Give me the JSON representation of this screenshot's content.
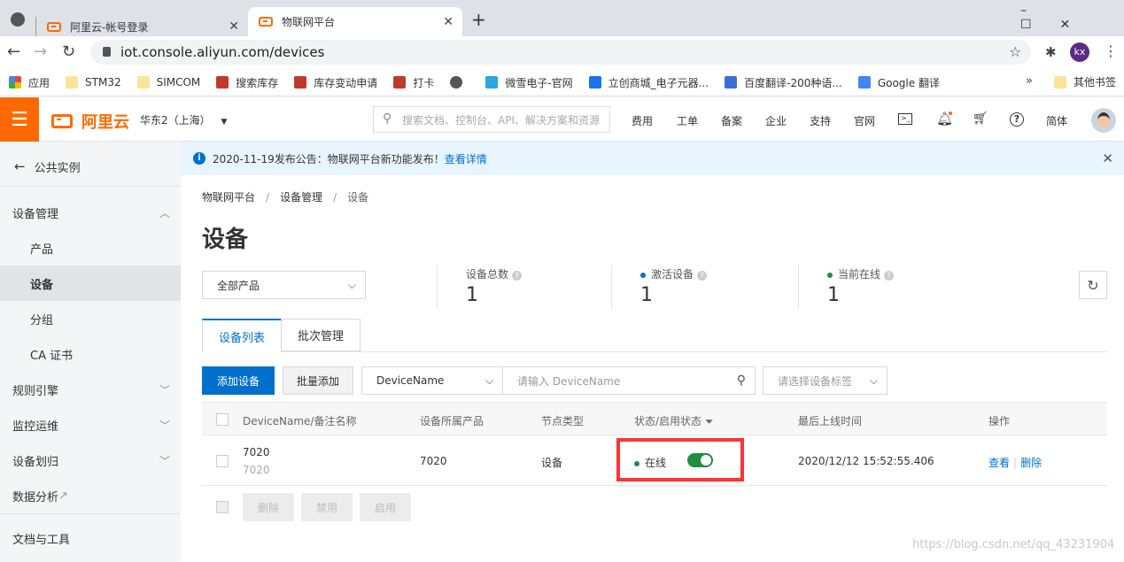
{
  "browser": {
    "tabs": [
      {
        "title": "阿里云-帐号登录",
        "active": false
      },
      {
        "title": "物联网平台",
        "active": true
      }
    ],
    "url": "iot.console.aliyun.com/devices",
    "profile": "kx",
    "bookmarks": [
      {
        "label": "应用",
        "icon": "apps-icon"
      },
      {
        "label": "STM32",
        "icon": "folder-icon"
      },
      {
        "label": "SIMCOM",
        "icon": "folder-icon"
      },
      {
        "label": "搜索库存",
        "icon": "erp-icon"
      },
      {
        "label": "库存变动申请",
        "icon": "erp-icon"
      },
      {
        "label": "打卡",
        "icon": "erp-icon"
      },
      {
        "label": "",
        "icon": "globe-icon"
      },
      {
        "label": "微雪电子-官网",
        "icon": "waveshare-icon"
      },
      {
        "label": "立创商城_电子元器...",
        "icon": "lc-icon"
      },
      {
        "label": "百度翻译-200种语...",
        "icon": "baidu-icon"
      },
      {
        "label": "Google 翻译",
        "icon": "google-translate-icon"
      }
    ],
    "other_bookmarks": "其他书签"
  },
  "header": {
    "logo": "阿里云",
    "region": "华东2（上海）",
    "search_placeholder": "搜索文档、控制台、API、解决方案和资源",
    "nav": [
      "费用",
      "工单",
      "备案",
      "企业",
      "支持",
      "官网"
    ],
    "lang": "简体",
    "accent": "#ff6a00"
  },
  "sidebar": {
    "back": "公共实例",
    "items": [
      {
        "label": "设备管理",
        "type": "group",
        "expanded": true
      },
      {
        "label": "产品",
        "type": "sub"
      },
      {
        "label": "设备",
        "type": "sub",
        "selected": true
      },
      {
        "label": "分组",
        "type": "sub"
      },
      {
        "label": "CA 证书",
        "type": "sub"
      },
      {
        "label": "规则引擎",
        "type": "group"
      },
      {
        "label": "监控运维",
        "type": "group"
      },
      {
        "label": "设备划归",
        "type": "group"
      },
      {
        "label": "数据分析",
        "type": "link"
      },
      {
        "label": "文档与工具",
        "type": "group"
      }
    ]
  },
  "notice": {
    "text": "2020-11-19发布公告：物联网平台新功能发布！",
    "link": "查看详情"
  },
  "breadcrumb": [
    "物联网平台",
    "设备管理",
    "设备"
  ],
  "page_title": "设备",
  "product_filter": "全部产品",
  "stats": [
    {
      "label": "设备总数",
      "value": "1"
    },
    {
      "label": "激活设备",
      "value": "1",
      "dot": "#0070cc"
    },
    {
      "label": "当前在线",
      "value": "1",
      "dot": "#1e8e3e"
    }
  ],
  "tabs": [
    "设备列表",
    "批次管理"
  ],
  "toolbar": {
    "add": "添加设备",
    "batch_add": "批量添加",
    "field": "DeviceName",
    "search_placeholder": "请输入 DeviceName",
    "tag_placeholder": "请选择设备标签"
  },
  "table": {
    "columns": [
      "DeviceName/备注名称",
      "设备所属产品",
      "节点类型",
      "状态/启用状态",
      "最后上线时间",
      "操作"
    ],
    "rows": [
      {
        "name": "7020",
        "note": "7020",
        "product": "7020",
        "node": "设备",
        "status": "在线",
        "enabled": true,
        "last_online": "2020/12/12 15:52:55.406",
        "actions": [
          "查看",
          "删除"
        ]
      }
    ]
  },
  "bulk": [
    "删除",
    "禁用",
    "启用"
  ],
  "watermark": "https://blog.csdn.net/qq_43231904",
  "colors": {
    "primary": "#0070cc",
    "online": "#1e8e3e",
    "highlight": "#f33"
  }
}
